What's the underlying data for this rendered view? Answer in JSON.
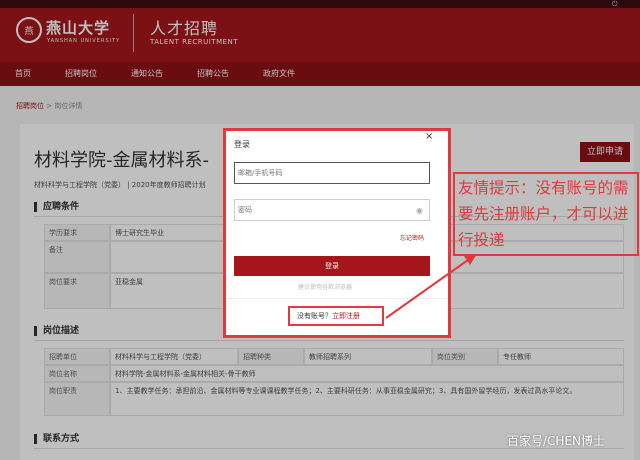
{
  "header": {
    "logo_seal": "燕",
    "logo_name": "燕山大学",
    "logo_en": "YANSHAN UNIVERSITY",
    "title": "人才招聘",
    "subtitle": "TALENT RECRUITMENT"
  },
  "nav": [
    "首页",
    "招聘岗位",
    "通知公告",
    "招聘公告",
    "政府文件"
  ],
  "breadcrumb": {
    "link": "招聘岗位",
    "sep": " > ",
    "current": "岗位详情"
  },
  "job": {
    "title": "材料学院-金属材料系-",
    "apply_label": "立即申请",
    "meta": "材料科学与工程学院（党委）  |  2020年度教师招聘计划"
  },
  "conditions": {
    "heading": "应聘条件",
    "rows": [
      {
        "label": "学历要求",
        "value": "博士研究生毕业"
      },
      {
        "label": "备注",
        "value": ""
      },
      {
        "label": "岗位要求",
        "value": "亚稳金属"
      }
    ]
  },
  "description": {
    "heading": "岗位描述",
    "unit_label": "招聘单位",
    "unit_value": "材料科学与工程学院（党委）",
    "type_label": "招聘种类",
    "type_value": "教师招聘系列",
    "category_label": "岗位类别",
    "category_value": "专任教师",
    "name_label": "岗位名称",
    "name_value": "材料学院-金属材料系-金属材料相关-骨干教师",
    "duty_label": "岗位职责",
    "duty_value": "1、主要教学任务：承担前沿、金属材料等专业课课程教学任务；2、主要科研任务：从事亚稳金属研究；3、具有国外留学经历，发表过高水平论文。"
  },
  "contact": {
    "heading": "联系方式"
  },
  "login_modal": {
    "title": "登录",
    "close": "×",
    "account_placeholder": "邮箱/手机号码",
    "password_placeholder": "密码",
    "eye_icon": "eye-icon",
    "forgot_label": "忘记密码",
    "login_label": "登录",
    "browser_tip": "建议使用谷歌浏览器",
    "no_account": "没有账号？",
    "register_link": "立即注册"
  },
  "annotation": {
    "tip": "友情提示：没有账号的需要先注册账户，才可以进行投递"
  },
  "watermark": "百家号/CHEN博士",
  "colors": {
    "brand": "#a5161c",
    "nav": "#8e1217",
    "annotation": "#e0393e"
  }
}
